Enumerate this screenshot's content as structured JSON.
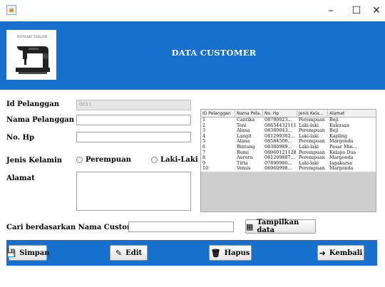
{
  "window": {
    "minimize": "–",
    "maximize": "☐",
    "close": "✕"
  },
  "header": {
    "title": "DATA CUSTOMER",
    "logo_text": "RUMAH TAILOR"
  },
  "form": {
    "id_label": "Id Pelanggan",
    "id_value": "0011",
    "name_label": "Nama Pelanggan",
    "name_value": "",
    "phone_label": "No. Hp",
    "phone_value": "",
    "gender_label": "Jenis Kelamin",
    "gender_options": [
      "Perempuan",
      "Laki-Laki"
    ],
    "address_label": "Alamat",
    "address_value": ""
  },
  "table": {
    "columns": [
      "ID Pelanggan",
      "Nama Pela...",
      "No. Hp",
      "Jenis Kela...",
      "Alamat"
    ],
    "rows": [
      [
        "1",
        "Cantika",
        "08780023...",
        "Perempuan",
        "Beji"
      ],
      [
        "2",
        "Toni",
        "08654432111",
        "Laki-laki",
        "Kukusan"
      ],
      [
        "3",
        "Aluna",
        "08380043...",
        "Perempuan",
        "Beji"
      ],
      [
        "4",
        "Langit",
        "081299302...",
        "Laki-laki",
        "Kapling"
      ],
      [
        "5",
        "Alana",
        "08584500...",
        "Perempuan",
        "Margonda"
      ],
      [
        "6",
        "Bintang",
        "08380989...",
        "Laki-laki",
        "Pasar Min..."
      ],
      [
        "7",
        "Bumi",
        "08960121128",
        "Perempuan",
        "Kelapa Dua"
      ],
      [
        "8",
        "Aurora",
        "081209887...",
        "Perempuan",
        "Margonda"
      ],
      [
        "9",
        "Tirta",
        "07890980...",
        "Laki-laki",
        "Jagakarsa"
      ],
      [
        "10",
        "Venus",
        "08960998...",
        "Perempuan",
        "Margonda"
      ]
    ]
  },
  "search": {
    "label": "Cari berdasarkan Nama Customer",
    "value": "",
    "button_label": "Tampilkan data"
  },
  "actions": {
    "save": "Simpan",
    "edit": "Edit",
    "delete": "Hapus",
    "back": "Kembali"
  },
  "colors": {
    "header_bg": "#1670cc",
    "footer_bg": "#1670cc"
  }
}
